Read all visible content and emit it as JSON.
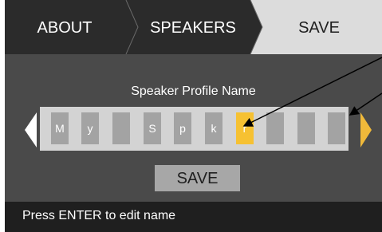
{
  "tabs": [
    {
      "label": "ABOUT",
      "active": false
    },
    {
      "label": "SPEAKERS",
      "active": false
    },
    {
      "label": "SAVE",
      "active": true
    }
  ],
  "editor": {
    "title": "Speaker Profile Name",
    "characters": [
      "M",
      "y",
      "",
      "S",
      "p",
      "k",
      "r",
      "",
      "",
      "",
      ""
    ],
    "selected_index": 6
  },
  "save_label": "SAVE",
  "status_text": "Press ENTER to edit name",
  "colors": {
    "background": "#4a4a4a",
    "tab_dark": "#2b2b2b",
    "tab_active": "#dcdcdc",
    "cell": "#a3a3a3",
    "cell_selected": "#f6c132",
    "arrow_right": "#f0b93a",
    "status_bar": "#1f1f1f"
  },
  "icons": {
    "left_arrow": "caret-left-icon",
    "right_arrow": "caret-right-icon"
  }
}
